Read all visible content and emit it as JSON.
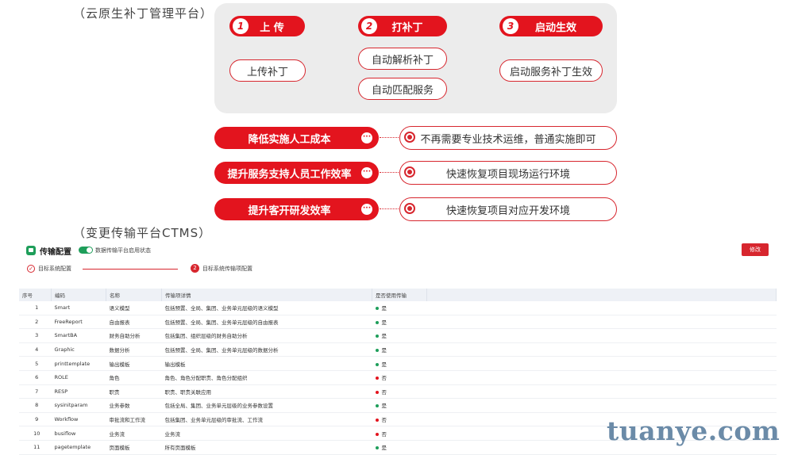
{
  "top_section_title": "（云原生补丁管理平台）",
  "steps": [
    {
      "num": "1",
      "label": "上 传"
    },
    {
      "num": "2",
      "label": "打补丁"
    },
    {
      "num": "3",
      "label": "启动生效"
    }
  ],
  "sub_actions": {
    "upload": "上传补丁",
    "auto_parse": "自动解析补丁",
    "auto_match": "自动匹配服务",
    "activate": "启动服务补丁生效"
  },
  "benefits": [
    {
      "label": "降低实施人工成本",
      "desc": "不再需要专业技术运维，普通实施即可"
    },
    {
      "label": "提升服务支持人员工作效率",
      "desc": "快速恢复项目现场运行环境"
    },
    {
      "label": "提升客开研发效率",
      "desc": "快速恢复项目对应开发环境"
    }
  ],
  "ctms_section_title": "（变更传输平台CTMS）",
  "ctms": {
    "title": "传输配置",
    "toggle_label": "数据传输平台启用状态",
    "edit_button": "修改",
    "step1": "目标系统配置",
    "step2_num": "2",
    "step2": "目标系统传输项配置",
    "columns": [
      "序号",
      "编码",
      "名称",
      "传输项详情",
      "是否使用传输"
    ],
    "rows": [
      {
        "no": "1",
        "code": "Smart",
        "name": "语义模型",
        "detail": "包括预置、全局、集团、业务单元层级的语义模型",
        "use": "是"
      },
      {
        "no": "2",
        "code": "FreeReport",
        "name": "自由报表",
        "detail": "包括预置、全局、集团、业务单元层级的自由报表",
        "use": "是"
      },
      {
        "no": "3",
        "code": "SmartBA",
        "name": "财务自助分析",
        "detail": "包括集团、组织层级的财务自助分析",
        "use": "是"
      },
      {
        "no": "4",
        "code": "Graphic",
        "name": "数据分析",
        "detail": "包括预置、全局、集团、业务单元层级的数据分析",
        "use": "是"
      },
      {
        "no": "5",
        "code": "printtemplate",
        "name": "输出模板",
        "detail": "输出模板",
        "use": "是"
      },
      {
        "no": "6",
        "code": "ROLE",
        "name": "角色",
        "detail": "角色、角色分配职责、角色分配组织",
        "use": "否"
      },
      {
        "no": "7",
        "code": "RESP",
        "name": "职责",
        "detail": "职责、职责关联应用",
        "use": "否"
      },
      {
        "no": "8",
        "code": "sysinitparam",
        "name": "业务参数",
        "detail": "包括全局、集团、业务单元层级的业务参数设置",
        "use": "是"
      },
      {
        "no": "9",
        "code": "Workflow",
        "name": "审批流和工作流",
        "detail": "包括集团、业务单元层级的审批流、工作流",
        "use": "否"
      },
      {
        "no": "10",
        "code": "busiflow",
        "name": "业务流",
        "detail": "业务流",
        "use": "否"
      },
      {
        "no": "11",
        "code": "pagetemplate",
        "name": "页面模板",
        "detail": "所有页面模板",
        "use": "是"
      }
    ]
  },
  "watermark": "tuanye.com",
  "colors": {
    "brand_red": "#e3141e",
    "status_yes": "#1e9e5a",
    "status_no": "#e3141e"
  }
}
